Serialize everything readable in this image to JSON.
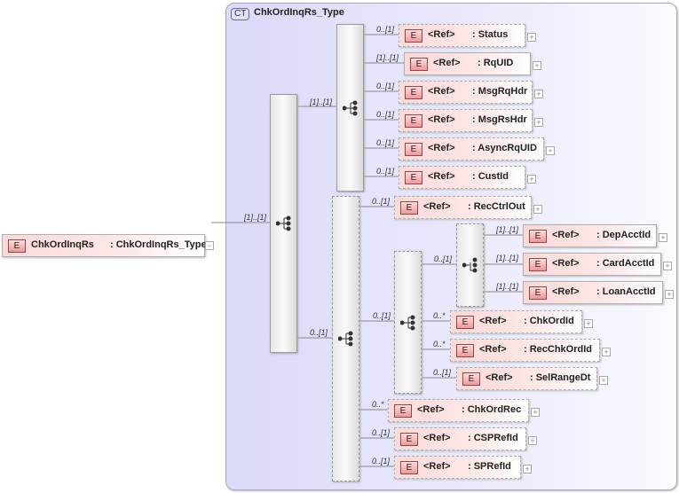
{
  "root": {
    "badge": "E",
    "name": "ChkOrdInqRs",
    "type": ": ChkOrdInqRs_Type",
    "collapse": "−"
  },
  "complex_type": {
    "badge": "CT",
    "title": "ChkOrdInqRs_Type"
  },
  "ref_label": "<Ref>",
  "badge": "E",
  "expand": "+",
  "cardinalities": {
    "seq_main": "[1]..[1]",
    "seq_header": "[1]..[1]",
    "seq_body": "0..[1]",
    "seq_sel": "0..[1]",
    "choice_acct": "0..[1]"
  },
  "elements": [
    {
      "name": ": Status",
      "card": "0..[1]"
    },
    {
      "name": ": RqUID",
      "card": "[1]..[1]"
    },
    {
      "name": ": MsgRqHdr",
      "card": "0..[1]"
    },
    {
      "name": ": MsgRsHdr",
      "card": "0..[1]"
    },
    {
      "name": ": AsyncRqUID",
      "card": "0..[1]"
    },
    {
      "name": ": CustId",
      "card": "0..[1]"
    },
    {
      "name": ": RecCtrlOut",
      "card": "0..[1]"
    },
    {
      "name": ": DepAcctId",
      "card": "[1]..[1]"
    },
    {
      "name": ": CardAcctId",
      "card": "[1]..[1]"
    },
    {
      "name": ": LoanAcctId",
      "card": "[1]..[1]"
    },
    {
      "name": ": ChkOrdId",
      "card": "0..*"
    },
    {
      "name": ": RecChkOrdId",
      "card": "0..*"
    },
    {
      "name": ": SelRangeDt",
      "card": "0..[1]"
    },
    {
      "name": ": ChkOrdRec",
      "card": "0..*"
    },
    {
      "name": ": CSPRefId",
      "card": "0..[1]"
    },
    {
      "name": ": SPRefId",
      "card": "0..[1]"
    }
  ]
}
